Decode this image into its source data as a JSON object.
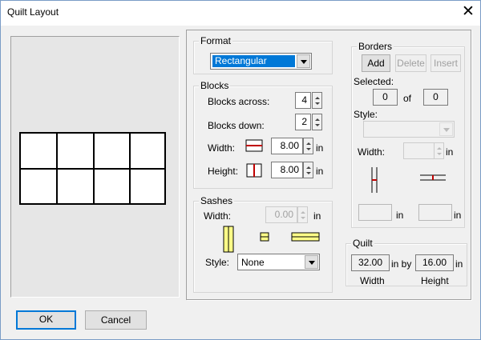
{
  "window": {
    "title": "Quilt Layout",
    "close_glyph": "✕"
  },
  "format": {
    "label": "Format",
    "value": "Rectangular"
  },
  "blocks": {
    "label": "Blocks",
    "across_label": "Blocks across:",
    "across_value": "4",
    "down_label": "Blocks down:",
    "down_value": "2",
    "width_label": "Width:",
    "width_value": "8.00",
    "width_unit": "in",
    "height_label": "Height:",
    "height_value": "8.00",
    "height_unit": "in"
  },
  "sashes": {
    "label": "Sashes",
    "width_label": "Width:",
    "width_value": "0.00",
    "width_unit": "in",
    "style_label": "Style:",
    "style_value": "None"
  },
  "borders": {
    "label": "Borders",
    "add_label": "Add",
    "delete_label": "Delete",
    "insert_label": "Insert",
    "selected_label": "Selected:",
    "selected_value": "0",
    "of_label": "of",
    "total_value": "0",
    "style_label": "Style:",
    "width_label": "Width:",
    "width_unit": "in",
    "left_unit": "in",
    "right_unit": "in"
  },
  "quilt": {
    "label": "Quilt",
    "width_value": "32.00",
    "by_label": "in by",
    "height_value": "16.00",
    "unit": "in",
    "width_caption": "Width",
    "height_caption": "Height"
  },
  "footer": {
    "ok_label": "OK",
    "cancel_label": "Cancel"
  },
  "colors": {
    "sash_fill": "#ffff88",
    "accent_line": "#c00000",
    "selection": "#0078d7"
  }
}
